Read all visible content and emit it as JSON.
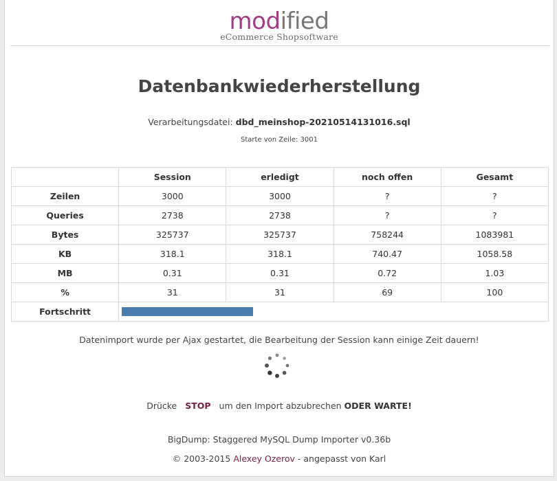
{
  "logo": {
    "word_part1": "mod",
    "word_part2": "ified",
    "tagline": "eCommerce Shopsoftware"
  },
  "title": "Datenbankwiederherstellung",
  "file": {
    "label": "Verarbeitungsdatei:",
    "name": "dbd_meinshop-20210514131016.sql"
  },
  "start_line": "Starte von Zeile: 3001",
  "table": {
    "headers": [
      "",
      "Session",
      "erledigt",
      "noch offen",
      "Gesamt"
    ],
    "rows": [
      {
        "label": "Zeilen",
        "values": [
          "3000",
          "3000",
          "?",
          "?"
        ]
      },
      {
        "label": "Queries",
        "values": [
          "2738",
          "2738",
          "?",
          "?"
        ]
      },
      {
        "label": "Bytes",
        "values": [
          "325737",
          "325737",
          "758244",
          "1083981"
        ]
      },
      {
        "label": "KB",
        "values": [
          "318.1",
          "318.1",
          "740.47",
          "1058.58"
        ]
      },
      {
        "label": "MB",
        "values": [
          "0.31",
          "0.31",
          "0.72",
          "1.03"
        ]
      },
      {
        "label": "%",
        "values": [
          "31",
          "31",
          "69",
          "100"
        ]
      }
    ],
    "progress_label": "Fortschritt",
    "progress_percent": 31
  },
  "ajax_message": "Datenimport wurde per Ajax gestartet, die Bearbeitung der Session kann einige Zeit dauern!",
  "stop": {
    "prefix": "Drücke",
    "link": "STOP",
    "middle": "um den Import abzubrechen",
    "suffix": "ODER WARTE!"
  },
  "footer": {
    "line1": "BigDump: Staggered MySQL Dump Importer v0.36b",
    "copyright": "© 2003-2015",
    "author": "Alexey Ozerov",
    "adapted": "- angepasst von Karl"
  },
  "colors": {
    "brand": "#a43b86",
    "link": "#7a1f46",
    "progress": "#4a7cae"
  },
  "icons": {
    "spinner": "loading-spinner-icon"
  }
}
